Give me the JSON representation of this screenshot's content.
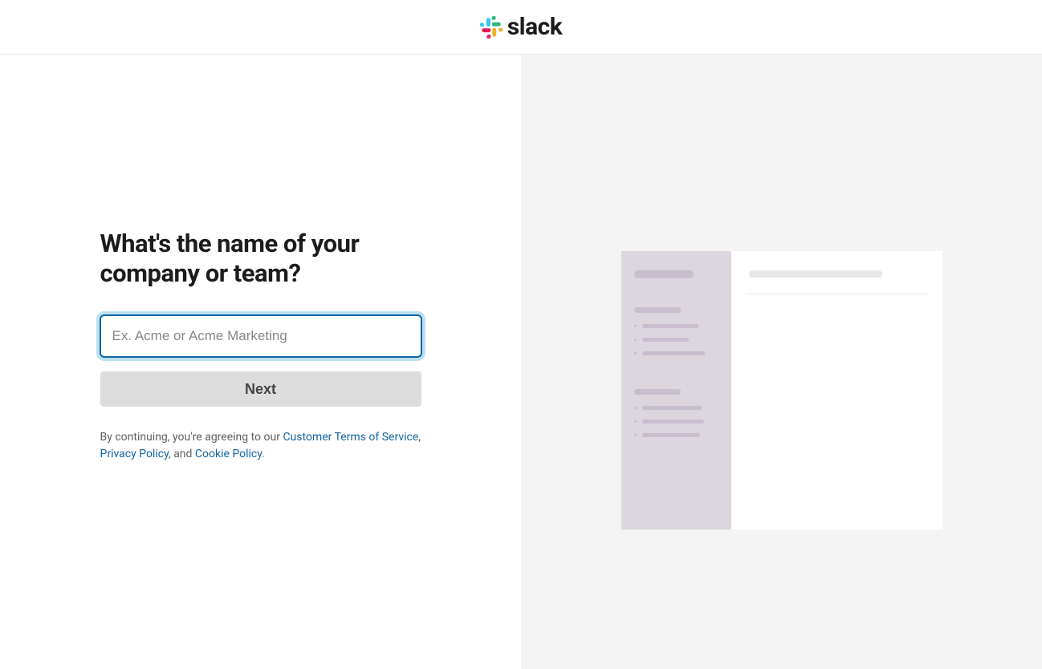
{
  "brand": {
    "name": "slack"
  },
  "form": {
    "heading": "What's the name of your company or team?",
    "input": {
      "placeholder": "Ex. Acme or Acme Marketing",
      "value": ""
    },
    "submit_label": "Next"
  },
  "legal": {
    "prefix": "By continuing, you're agreeing to our ",
    "terms_link": "Customer Terms of Service",
    "separator1": ", ",
    "privacy_link": "Privacy Policy",
    "separator2": ", and ",
    "cookie_link": "Cookie Policy",
    "suffix": "."
  }
}
